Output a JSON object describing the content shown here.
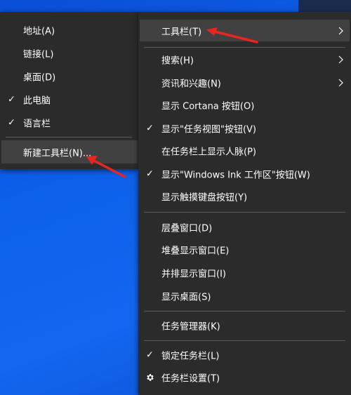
{
  "sub_menu": {
    "items": [
      {
        "label": "地址(A)"
      },
      {
        "label": "链接(L)"
      },
      {
        "label": "桌面(D)"
      },
      {
        "label": "此电脑",
        "checked": true
      },
      {
        "label": "语言栏",
        "checked": true
      },
      {
        "label": "新建工具栏(N)..."
      }
    ]
  },
  "main_menu": {
    "items": [
      {
        "label": "工具栏(T)",
        "has_submenu": true
      },
      {
        "label": "搜索(H)",
        "has_submenu": true
      },
      {
        "label": "资讯和兴趣(N)",
        "has_submenu": true
      },
      {
        "label": "显示 Cortana 按钮(O)"
      },
      {
        "label": "显示\"任务视图\"按钮(V)",
        "checked": true
      },
      {
        "label": "在任务栏上显示人脉(P)"
      },
      {
        "label": "显示\"Windows Ink 工作区\"按钮(W)",
        "checked": true
      },
      {
        "label": "显示触摸键盘按钮(Y)"
      },
      {
        "label": "层叠窗口(D)"
      },
      {
        "label": "堆叠显示窗口(E)"
      },
      {
        "label": "并排显示窗口(I)"
      },
      {
        "label": "显示桌面(S)"
      },
      {
        "label": "任务管理器(K)"
      },
      {
        "label": "锁定任务栏(L)",
        "checked": true
      },
      {
        "label": "任务栏设置(T)",
        "icon": "gear-icon"
      }
    ]
  },
  "colors": {
    "menu_bg": "#2b2b2b",
    "highlight_bg": "#414141",
    "separator": "#5a5a5a",
    "annotation_arrow": "#e8251f",
    "desktop_blue": "#0d60e8"
  }
}
